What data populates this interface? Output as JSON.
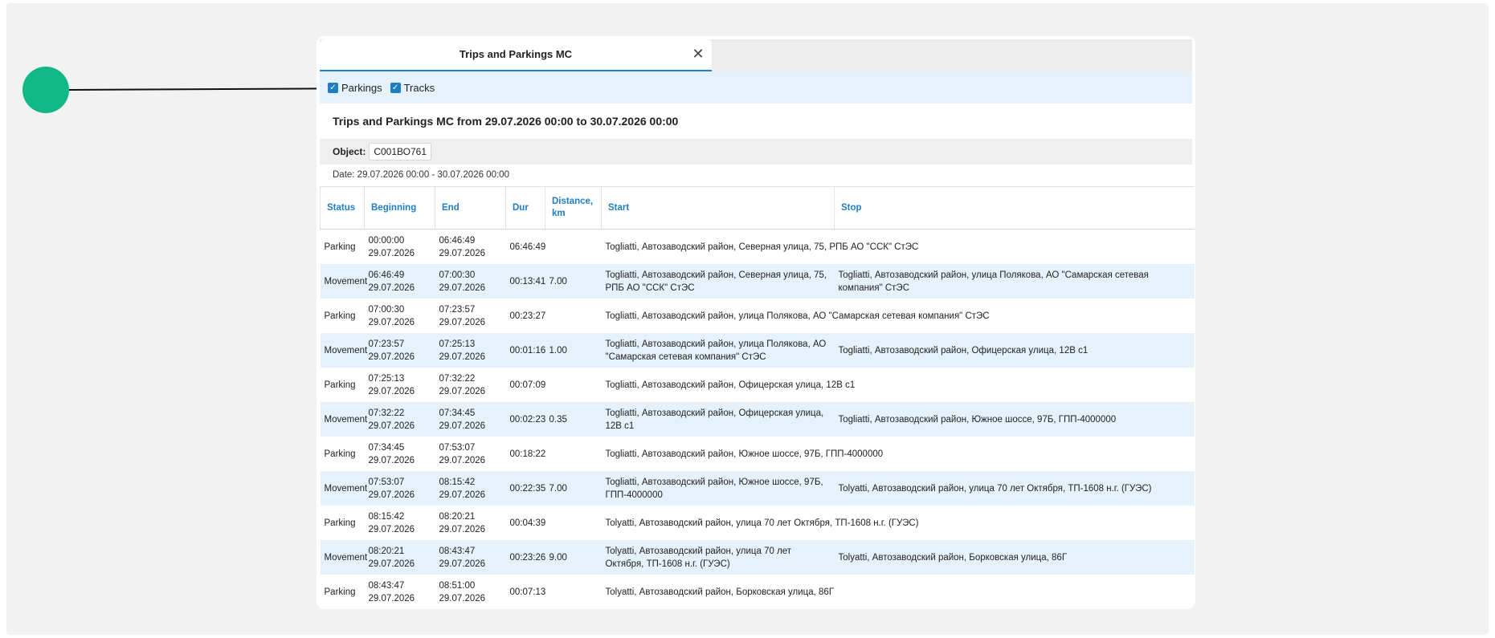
{
  "window": {
    "tab_title": "Trips and Parkings MC",
    "close_glyph": "✕"
  },
  "filters": {
    "parkings": {
      "label": "Parkings",
      "checked": true
    },
    "tracks": {
      "label": "Tracks",
      "checked": true
    }
  },
  "report": {
    "title": "Trips and Parkings MC from 29.07.2026 00:00 to 30.07.2026 00:00",
    "object_label": "Object:",
    "object_value": "С001ВО761",
    "date_line": "Date: 29.07.2026 00:00 - 30.07.2026 00:00"
  },
  "table": {
    "headers": {
      "status": "Status",
      "beginning": "Beginning",
      "end": "End",
      "dur": "Dur",
      "distance": "Distance, km",
      "start": "Start",
      "stop": "Stop"
    },
    "rows": [
      {
        "status": "Parking",
        "begin_time": "00:00:00",
        "begin_date": "29.07.2026",
        "end_time": "06:46:49",
        "end_date": "29.07.2026",
        "dur": "06:46:49",
        "distance": "",
        "start": "Togliatti, Автозаводский район, Северная улица, 75, РПБ АО \"ССК\" СтЭС",
        "stop": ""
      },
      {
        "status": "Movement",
        "begin_time": "06:46:49",
        "begin_date": "29.07.2026",
        "end_time": "07:00:30",
        "end_date": "29.07.2026",
        "dur": "00:13:41",
        "distance": "7.00",
        "start": "Togliatti, Автозаводский район, Северная улица, 75, РПБ АО \"ССК\" СтЭС",
        "stop": "Togliatti, Автозаводский район, улица Полякова, АО \"Самарская сетевая компания\" СтЭС"
      },
      {
        "status": "Parking",
        "begin_time": "07:00:30",
        "begin_date": "29.07.2026",
        "end_time": "07:23:57",
        "end_date": "29.07.2026",
        "dur": "00:23:27",
        "distance": "",
        "start": "Togliatti, Автозаводский район, улица Полякова, АО \"Самарская сетевая компания\" СтЭС",
        "stop": ""
      },
      {
        "status": "Movement",
        "begin_time": "07:23:57",
        "begin_date": "29.07.2026",
        "end_time": "07:25:13",
        "end_date": "29.07.2026",
        "dur": "00:01:16",
        "distance": "1.00",
        "start": "Togliatti, Автозаводский район, улица Полякова, АО \"Самарская сетевая компания\" СтЭС",
        "stop": "Togliatti, Автозаводский район, Офицерская улица, 12В с1"
      },
      {
        "status": "Parking",
        "begin_time": "07:25:13",
        "begin_date": "29.07.2026",
        "end_time": "07:32:22",
        "end_date": "29.07.2026",
        "dur": "00:07:09",
        "distance": "",
        "start": "Togliatti, Автозаводский район, Офицерская улица, 12В с1",
        "stop": ""
      },
      {
        "status": "Movement",
        "begin_time": "07:32:22",
        "begin_date": "29.07.2026",
        "end_time": "07:34:45",
        "end_date": "29.07.2026",
        "dur": "00:02:23",
        "distance": "0.35",
        "start": "Togliatti, Автозаводский район, Офицерская улица, 12В с1",
        "stop": "Togliatti, Автозаводский район, Южное шоссе, 97Б, ГПП-4000000"
      },
      {
        "status": "Parking",
        "begin_time": "07:34:45",
        "begin_date": "29.07.2026",
        "end_time": "07:53:07",
        "end_date": "29.07.2026",
        "dur": "00:18:22",
        "distance": "",
        "start": "Togliatti, Автозаводский район, Южное шоссе, 97Б, ГПП-4000000",
        "stop": ""
      },
      {
        "status": "Movement",
        "begin_time": "07:53:07",
        "begin_date": "29.07.2026",
        "end_time": "08:15:42",
        "end_date": "29.07.2026",
        "dur": "00:22:35",
        "distance": "7.00",
        "start": "Togliatti, Автозаводский район, Южное шоссе, 97Б, ГПП-4000000",
        "stop": "Tolyatti, Автозаводский район, улица 70 лет Октября, ТП-1608 н.г. (ГУЭС)"
      },
      {
        "status": "Parking",
        "begin_time": "08:15:42",
        "begin_date": "29.07.2026",
        "end_time": "08:20:21",
        "end_date": "29.07.2026",
        "dur": "00:04:39",
        "distance": "",
        "start": "Tolyatti, Автозаводский район, улица 70 лет Октября, ТП-1608 н.г. (ГУЭС)",
        "stop": ""
      },
      {
        "status": "Movement",
        "begin_time": "08:20:21",
        "begin_date": "29.07.2026",
        "end_time": "08:43:47",
        "end_date": "29.07.2026",
        "dur": "00:23:26",
        "distance": "9.00",
        "start": "Tolyatti, Автозаводский район, улица 70 лет Октября, ТП-1608 н.г. (ГУЭС)",
        "stop": "Tolyatti, Автозаводский район, Борковская улица, 86Г"
      },
      {
        "status": "Parking",
        "begin_time": "08:43:47",
        "begin_date": "29.07.2026",
        "end_time": "08:51:00",
        "end_date": "29.07.2026",
        "dur": "00:07:13",
        "distance": "",
        "start": "Tolyatti, Автозаводский район, Борковская улица, 86Г",
        "stop": ""
      }
    ]
  }
}
